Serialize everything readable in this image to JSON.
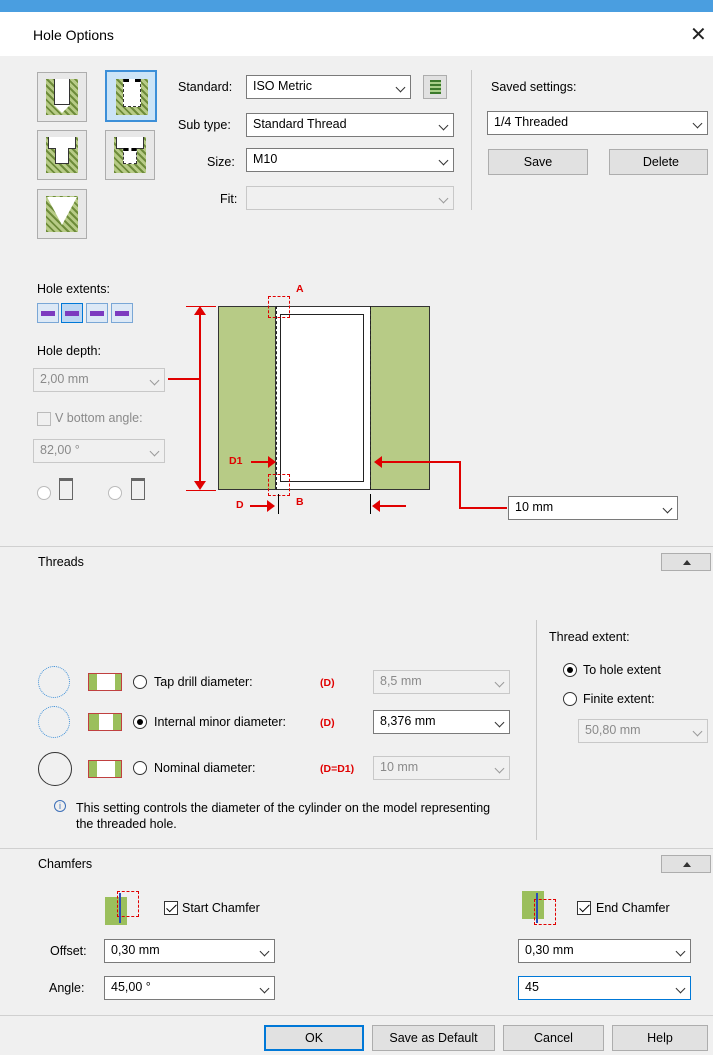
{
  "dialog": {
    "title": "Hole Options",
    "close_glyph": "✕"
  },
  "hole_types": {
    "icons": [
      "simple-hole-icon",
      "tapped-hole-icon",
      "counterbore-hole-icon",
      "counterbore-tapped-icon",
      "countersink-hole-icon"
    ],
    "selected": "tapped-hole-icon"
  },
  "standard": {
    "label": "Standard:",
    "value": "ISO Metric"
  },
  "sub_type": {
    "label": "Sub type:",
    "value": "Standard Thread"
  },
  "size": {
    "label": "Size:",
    "value": "M10"
  },
  "fit": {
    "label": "Fit:",
    "value": ""
  },
  "saved_settings": {
    "label": "Saved settings:",
    "value": "1/4 Threaded",
    "save": "Save",
    "delete": "Delete"
  },
  "hole_extents": {
    "label": "Hole extents:"
  },
  "hole_depth": {
    "label": "Hole depth:",
    "value": "2,00 mm"
  },
  "v_bottom": {
    "label": "V bottom angle:",
    "value": "82,00 °"
  },
  "diagram": {
    "label_a": "A",
    "label_b": "B",
    "label_d": "D",
    "label_d1": "D1",
    "size_value": "10 mm"
  },
  "threads": {
    "header": "Threads",
    "tap_drill": {
      "label": "Tap drill diameter:",
      "code": "(D)",
      "value": "8,5 mm"
    },
    "internal_minor": {
      "label": "Internal minor diameter:",
      "code": "(D)",
      "value": "8,376 mm"
    },
    "nominal": {
      "label": "Nominal diameter:",
      "code": "(D=D1)",
      "value": "10 mm"
    },
    "info": "This setting controls the diameter of the cylinder on the model representing the threaded hole.",
    "thread_extent": {
      "label": "Thread extent:",
      "to_hole": "To hole extent",
      "finite": "Finite extent:",
      "finite_value": "50,80 mm"
    }
  },
  "chamfers": {
    "header": "Chamfers",
    "start_label": "Start Chamfer",
    "end_label": "End Chamfer",
    "offset_label": "Offset:",
    "angle_label": "Angle:",
    "start_offset": "0,30 mm",
    "start_angle": "45,00 °",
    "end_offset": "0,30 mm",
    "end_angle": "45"
  },
  "footer": {
    "ok": "OK",
    "save_default": "Save as Default",
    "cancel": "Cancel",
    "help": "Help"
  },
  "colors": {
    "accent": "#0078d7",
    "dimension_red": "#e00000",
    "material_green": "#b7cb86"
  }
}
